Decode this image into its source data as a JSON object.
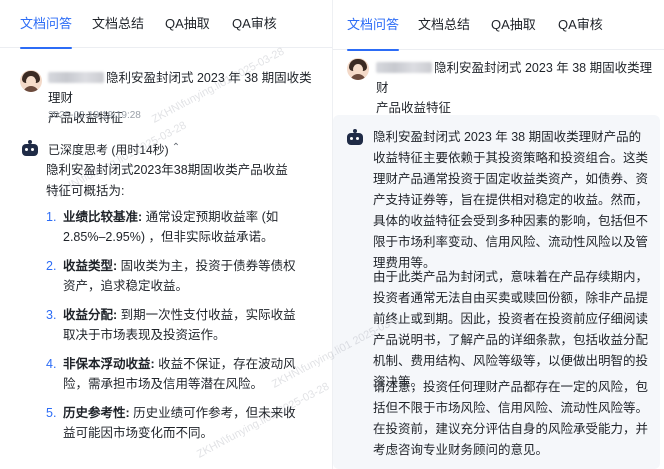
{
  "left": {
    "tabs": [
      {
        "label": "文档问答",
        "active": true
      },
      {
        "label": "文档总结",
        "active": false
      },
      {
        "label": "QA抽取",
        "active": false
      },
      {
        "label": "QA审核",
        "active": false
      }
    ],
    "question": {
      "title_line1": "隐利安盈封闭式 2023 年 38 期固收类理财",
      "title_line2": "产品收益特征",
      "timestamp": "2025-02-19 19:19:28"
    },
    "thinking_label": "已深度思考 (用时14秒)",
    "intro": [
      "隐利安盈封闭式2023年38期固收类产品收益",
      "特征可概括为:"
    ],
    "items": [
      {
        "num": "1.",
        "label": "业绩比较基准:",
        "text": "通常设定预期收益率 (如 2.85%–2.95%) ，但非实际收益承诺。"
      },
      {
        "num": "2.",
        "label": "收益类型:",
        "text": "固收类为主，投资于债券等债权资产，追求稳定收益。"
      },
      {
        "num": "3.",
        "label": "收益分配:",
        "text": "到期一次性支付收益，实际收益取决于市场表现及投资运作。"
      },
      {
        "num": "4.",
        "label": "非保本浮动收益:",
        "text": "收益不保证，存在波动风险，需承担市场及信用等潜在风险。"
      },
      {
        "num": "5.",
        "label": "历史参考性:",
        "text": "历史业绩可作参考，但未来收益可能因市场变化而不同。"
      }
    ]
  },
  "right": {
    "tabs": [
      {
        "label": "文档问答",
        "active": true
      },
      {
        "label": "文档总结",
        "active": false
      },
      {
        "label": "QA抽取",
        "active": false
      },
      {
        "label": "QA审核",
        "active": false
      }
    ],
    "question": {
      "title_line1": "隐利安盈封闭式 2023 年 38 期固收类理财",
      "title_line2": "产品收益特征"
    },
    "answer": [
      "隐利安盈封闭式 2023 年 38 期固收类理财产品的收益特征主要依赖于其投资策略和投资组合。这类理财产品通常投资于固定收益类资产，如债券、资产支持证券等，旨在提供相对稳定的收益。然而，具体的收益特征会受到多种因素的影响，包括但不限于市场利率变动、信用风险、流动性风险以及管理费用等。",
      "由于此类产品为封闭式，意味着在产品存续期内，投资者通常无法自由买卖或赎回份额，除非产品提前终止或到期。因此，投资者在投资前应仔细阅读产品说明书，了解产品的详细条款，包括收益分配机制、费用结构、风险等级等，以便做出明智的投资决策。",
      "请注意，投资任何理财产品都存在一定的风险，包括但不限于市场风险、信用风险、流动性风险等。在投资前，建议充分评估自身的风险承受能力，并考虑咨询专业财务顾问的意见。"
    ]
  },
  "watermarks": [
    "ZKHN\\fiunying.li01 2025-03-28",
    "ZKHN\\funying.li01 2025-03-28",
    "ZKHN\\funying.li01 2025-03-2",
    "ZKHN\\funying.li01 2025-03-28"
  ],
  "colors": {
    "accent": "#2c6cf6",
    "text": "#1f2329",
    "muted": "#9aa0a8",
    "card_bg": "#f5f7fa"
  }
}
